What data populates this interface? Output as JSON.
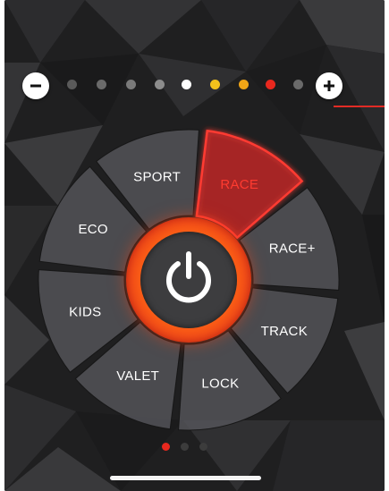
{
  "level_bar": {
    "minus_icon": "minus-icon",
    "plus_icon": "plus-icon",
    "dots": [
      {
        "color": "#5a5a5a"
      },
      {
        "color": "#6a6a6a"
      },
      {
        "color": "#7a7a7a"
      },
      {
        "color": "#8c8c8c"
      },
      {
        "color": "#ffffff"
      },
      {
        "color": "#f3c21c"
      },
      {
        "color": "#f0a516"
      },
      {
        "color": "#e8281e"
      },
      {
        "color": "#6a6a6a"
      }
    ],
    "accent_color": "#e22b25"
  },
  "modes": [
    {
      "id": "sport",
      "label": "SPORT",
      "active": false
    },
    {
      "id": "race",
      "label": "RACE",
      "active": true
    },
    {
      "id": "race-plus",
      "label": "RACE+",
      "active": false
    },
    {
      "id": "track",
      "label": "TRACK",
      "active": false
    },
    {
      "id": "lock",
      "label": "LOCK",
      "active": false
    },
    {
      "id": "valet",
      "label": "VALET",
      "active": false
    },
    {
      "id": "kids",
      "label": "KIDS",
      "active": false
    },
    {
      "id": "eco",
      "label": "ECO",
      "active": false
    }
  ],
  "power_button": {
    "icon": "power-icon",
    "ring_color": "#ff6a12"
  },
  "pagination": {
    "count": 3,
    "current": 1,
    "active_color": "#e8281e",
    "inactive_color": "#3c3c3c"
  },
  "colors": {
    "active_segment": "#ff3b30",
    "segment_fill": "#55565a",
    "background": "#1e1e1f"
  }
}
